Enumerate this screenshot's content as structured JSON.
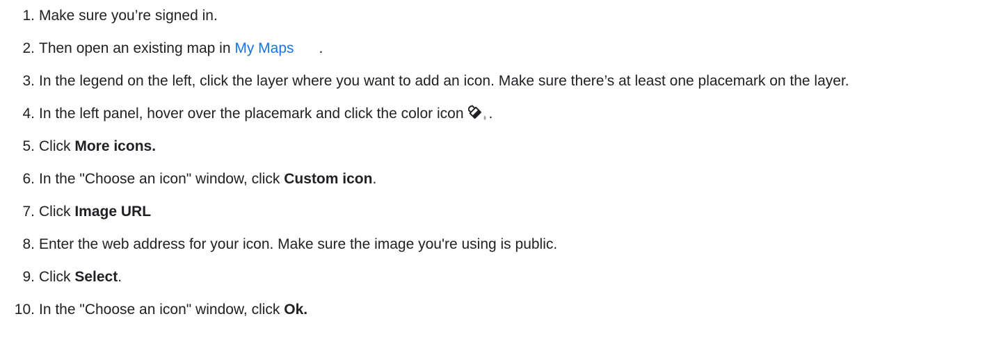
{
  "steps": [
    {
      "num": "1.",
      "text": "Make sure you’re signed in."
    },
    {
      "num": "2.",
      "pre": "Then open an existing map in ",
      "link": "My Maps",
      "post": "."
    },
    {
      "num": "3.",
      "text": "In the legend on the left, click the layer where you want to add an icon. Make sure there’s at least one placemark on the layer."
    },
    {
      "num": "4.",
      "pre": "In the left panel, hover over the placemark and click the color icon",
      "post": ".",
      "icon": "paint-bucket-icon"
    },
    {
      "num": "5.",
      "pre": "Click ",
      "bold": "More icons."
    },
    {
      "num": "6.",
      "pre": "In the \"Choose an icon\" window, click ",
      "bold": "Custom icon",
      "post": "."
    },
    {
      "num": "7.",
      "pre": "Click ",
      "bold": "Image URL"
    },
    {
      "num": "8.",
      "text": "Enter the web address for your icon. Make sure the image you're using is public."
    },
    {
      "num": "9.",
      "pre": "Click ",
      "bold": "Select",
      "post": "."
    },
    {
      "num": "10.",
      "pre": "In the \"Choose an icon\" window, click ",
      "bold": "Ok."
    }
  ]
}
